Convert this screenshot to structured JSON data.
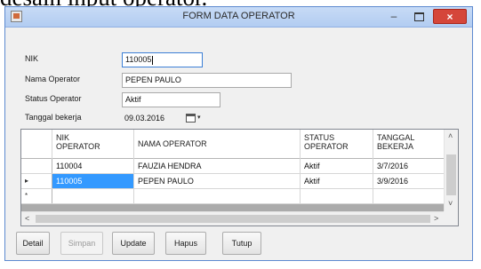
{
  "page_caption": "desain input operator.",
  "window": {
    "title": "FORM DATA OPERATOR",
    "minimize_glyph": "–",
    "close_glyph": "×",
    "icon": "app-form-icon"
  },
  "form": {
    "nik_label": "NIK",
    "nik_value": "110005",
    "nama_label": "Nama Operator",
    "nama_value": "PEPEN PAULO",
    "status_label": "Status Operator",
    "status_value": "Aktif",
    "tanggal_label": "Tanggal bekerja",
    "tanggal_value": "09.03.2016",
    "dropdown_glyph": "▾"
  },
  "grid": {
    "columns": [
      {
        "line1": "NIK",
        "line2": "OPERATOR"
      },
      {
        "line1": "NAMA OPERATOR",
        "line2": ""
      },
      {
        "line1": "STATUS",
        "line2": "OPERATOR"
      },
      {
        "line1": "TANGGAL",
        "line2": "BEKERJA"
      }
    ],
    "rows": [
      {
        "marker": "",
        "nik": "110004",
        "nama": "FAUZIA HENDRA",
        "status": "Aktif",
        "tanggal": "3/7/2016"
      },
      {
        "marker": "▸",
        "nik": "110005",
        "nama": "PEPEN PAULO",
        "status": "Aktif",
        "tanggal": "3/9/2016"
      },
      {
        "marker": "*",
        "nik": "",
        "nama": "",
        "status": "",
        "tanggal": ""
      }
    ],
    "scroll_up": "˄",
    "scroll_down": "˅",
    "scroll_left": "<",
    "scroll_right": ">"
  },
  "buttons": {
    "detail": "Detail",
    "simpan": "Simpan",
    "update": "Update",
    "hapus": "Hapus",
    "tutup": "Tutup"
  },
  "colors": {
    "titlebar": "#b8d1f3",
    "close_button": "#d5463a",
    "selection": "#3399ff",
    "grid_background": "#ababab"
  }
}
